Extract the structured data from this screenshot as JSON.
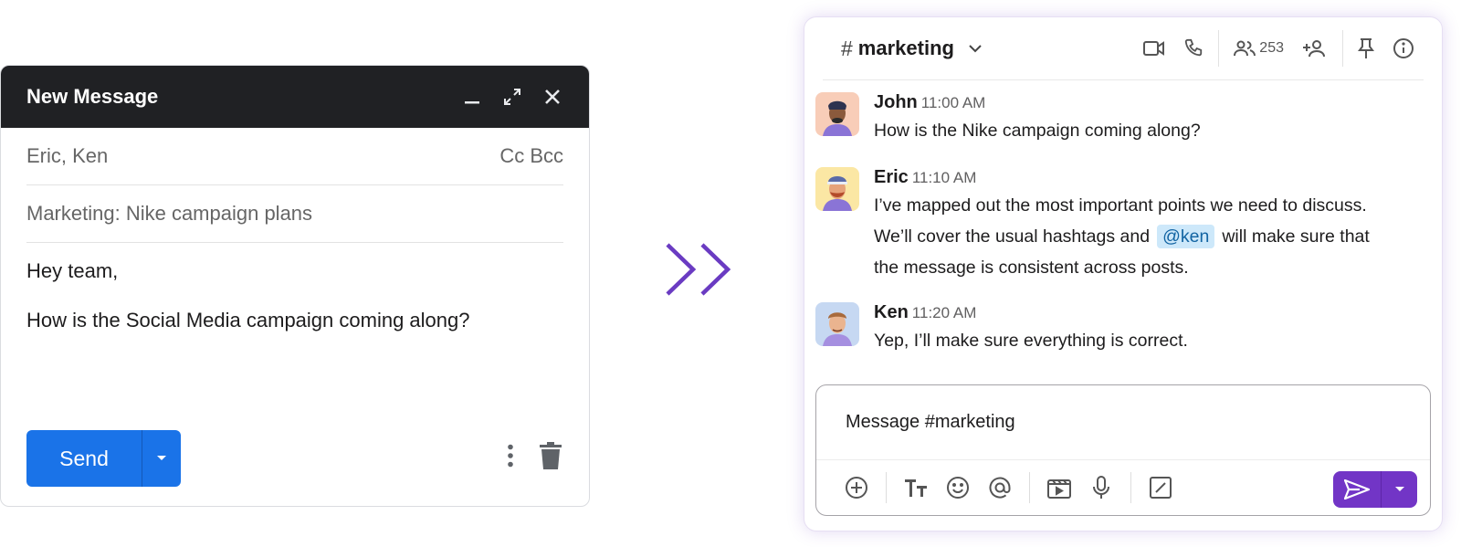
{
  "compose": {
    "title": "New Message",
    "to": "Eric, Ken",
    "cc_bcc": "Cc Bcc",
    "subject": "Marketing: Nike campaign plans",
    "body_line1": "Hey team,",
    "body_line2": "How is the Social Media campaign coming along?",
    "send_label": "Send"
  },
  "chat": {
    "channel": "marketing",
    "hash": "#",
    "member_count": "253",
    "messages": [
      {
        "author": "John",
        "time": "11:00 AM",
        "text": "How is the Nike campaign coming along?"
      },
      {
        "author": "Eric",
        "time": "11:10 AM",
        "line1": "I’ve mapped out the most important points we need to discuss.",
        "line2_pre": "We’ll cover the usual hashtags and",
        "mention": "@ken",
        "line2_post": "will make sure that",
        "line3": "the message is consistent across posts."
      },
      {
        "author": "Ken",
        "time": "11:20 AM",
        "text": "Yep, I’ll make sure everything is correct."
      }
    ],
    "composer_placeholder": "Message #marketing"
  },
  "colors": {
    "compose_header": "#202124",
    "send_blue": "#1a73e8",
    "chat_purple": "#7235c6",
    "mention_bg": "#cde8fa"
  }
}
